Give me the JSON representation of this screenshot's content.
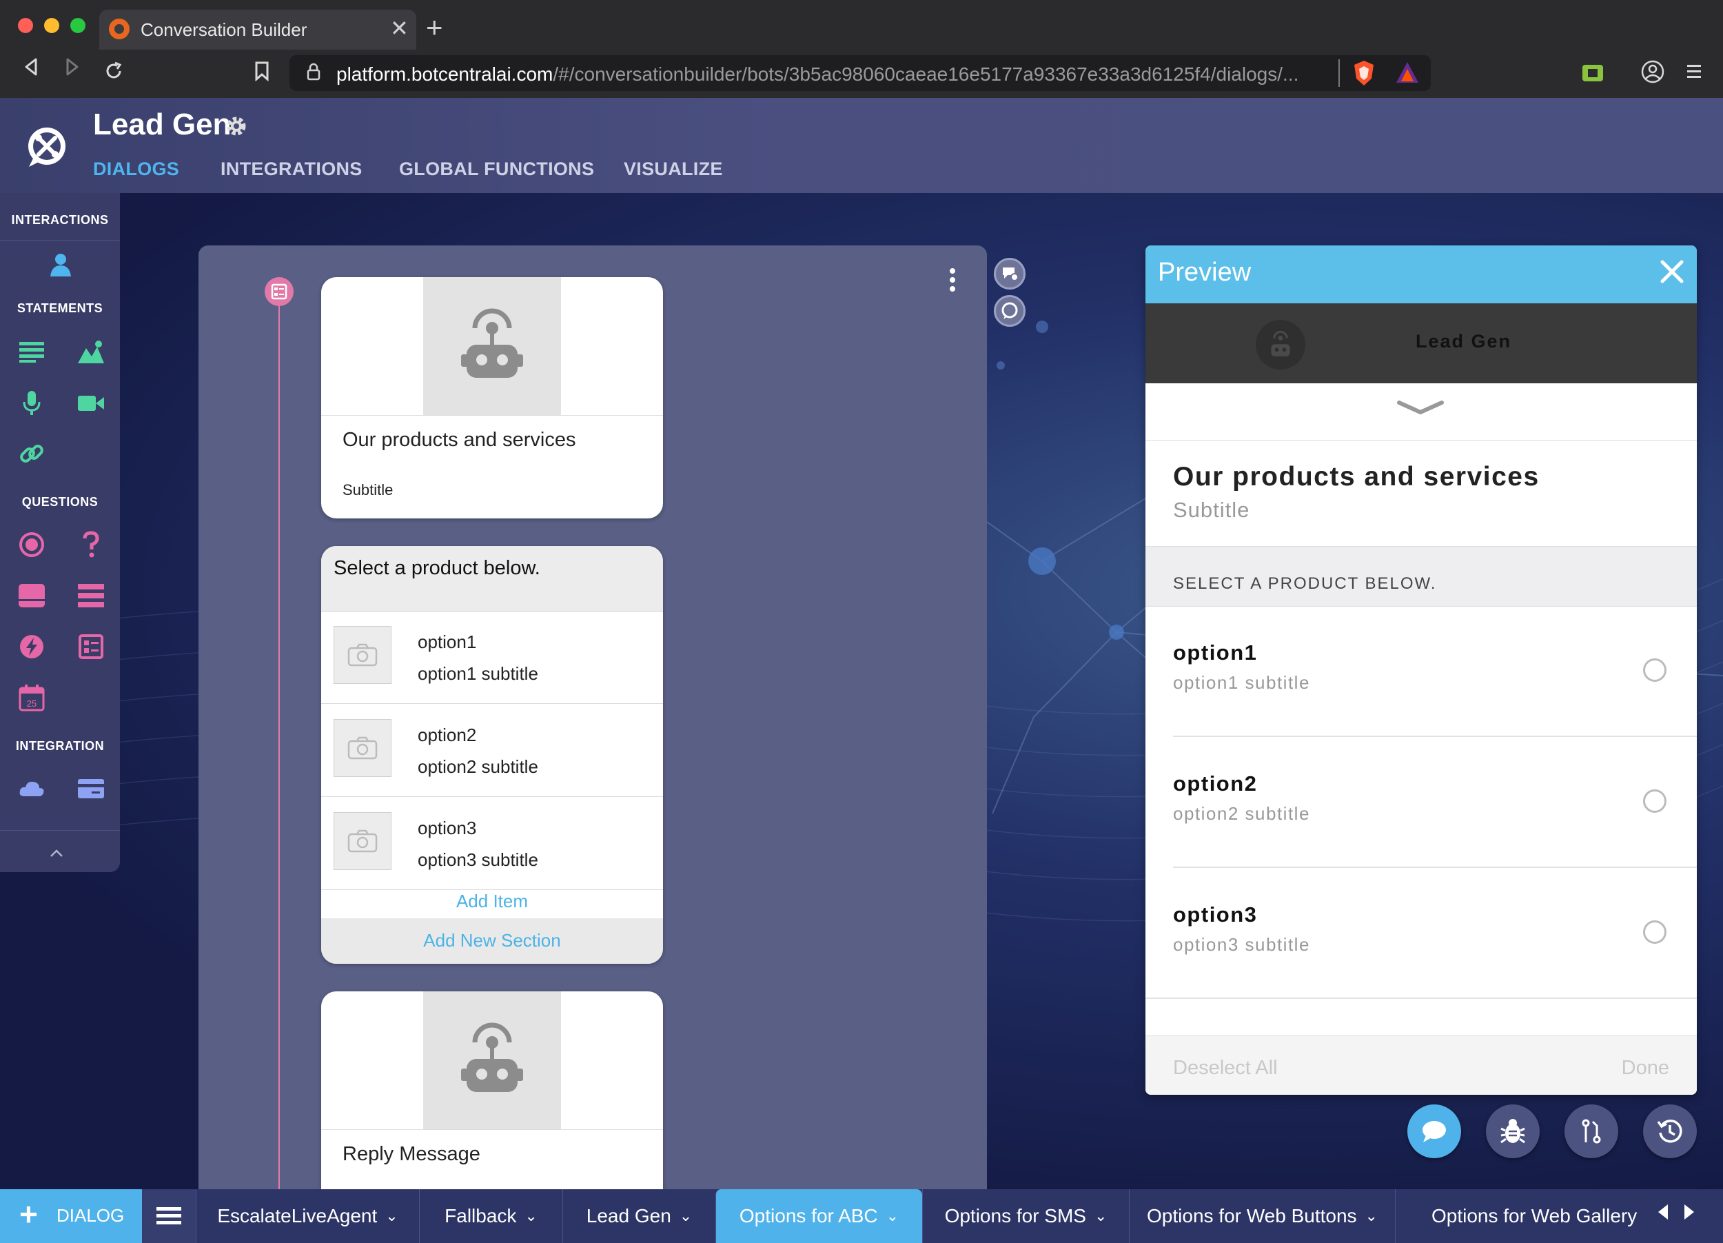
{
  "browser": {
    "tab_title": "Conversation Builder",
    "tab_close": "✕",
    "new_tab": "+",
    "url_host": "platform.botcentralai.com",
    "url_path": "/#/conversationbuilder/bots/3b5ac98060caeae16e5177a93367e33a3d6125f4/dialogs/..."
  },
  "app": {
    "bot_name": "Lead Gen",
    "nav_tabs": [
      "DIALOGS",
      "INTEGRATIONS",
      "GLOBAL FUNCTIONS",
      "VISUALIZE"
    ],
    "active_tab": "DIALOGS"
  },
  "tool_panel": {
    "sections": {
      "interactions": "INTERACTIONS",
      "statements": "STATEMENTS",
      "questions": "QUESTIONS",
      "integration": "INTEGRATION"
    },
    "calendar_day": "25",
    "colors": {
      "interactions": "#4fb5ef",
      "statements": "#4fd6a0",
      "questions": "#e667a7",
      "integration": "#8da2f2"
    }
  },
  "editor": {
    "card1": {
      "title": "Our products and services",
      "subtitle": "Subtitle"
    },
    "list_card": {
      "header": "Select a product below.",
      "items": [
        {
          "title": "option1",
          "subtitle": "option1 subtitle"
        },
        {
          "title": "option2",
          "subtitle": "option2 subtitle"
        },
        {
          "title": "option3",
          "subtitle": "option3 subtitle"
        }
      ],
      "add_item": "Add Item",
      "add_section": "Add New Section"
    },
    "card3": {
      "title": "Reply Message"
    }
  },
  "preview": {
    "title": "Preview",
    "bot_name": "Lead Gen",
    "card_title": "Our products and services",
    "card_subtitle": "Subtitle",
    "section_header": "SELECT A PRODUCT BELOW.",
    "options": [
      {
        "title": "option1",
        "subtitle": "option1 subtitle",
        "selected": false
      },
      {
        "title": "option2",
        "subtitle": "option2 subtitle",
        "selected": false
      },
      {
        "title": "option3",
        "subtitle": "option3 subtitle",
        "selected": false
      }
    ],
    "deselect_all": "Deselect All",
    "done": "Done",
    "header_color": "#5bbfe9"
  },
  "bottom_bar": {
    "add_dialog_label": "DIALOG",
    "dialog_tabs": [
      "EscalateLiveAgent",
      "Fallback",
      "Lead Gen",
      "Options for ABC",
      "Options for SMS",
      "Options for Web Buttons",
      "Options for Web Gallery"
    ],
    "active_dialog": "Options for ABC",
    "accent_color": "#4fb2ea"
  }
}
